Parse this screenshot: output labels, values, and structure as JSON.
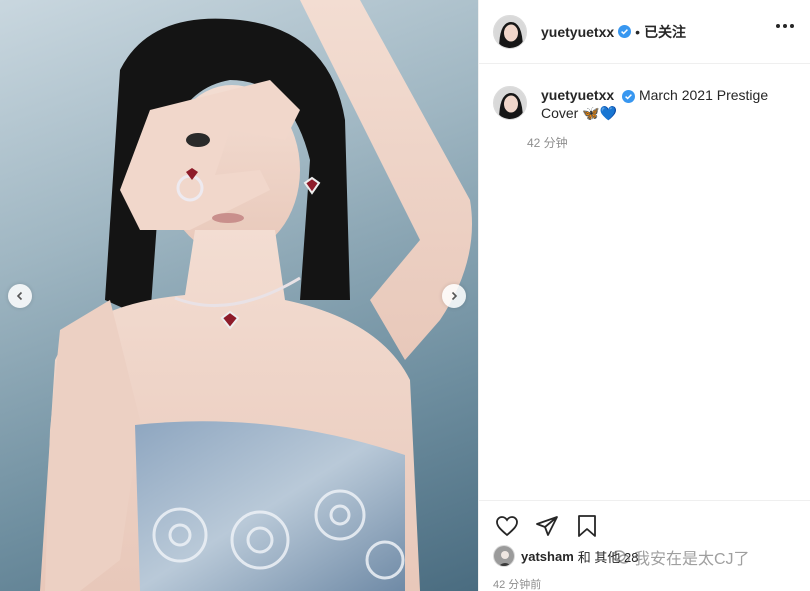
{
  "post": {
    "username": "yuetyuetxx",
    "follow_status": "已关注",
    "separator": "•",
    "caption": "March 2021 Prestige Cover",
    "caption_emojis": "🦋💙",
    "time_ago": "42 分钟",
    "liked_by_user": "yatsham",
    "liked_by_text": "和 其他 28",
    "post_time": "42 分钟前"
  },
  "watermark": {
    "text": "我安在是太CJ了"
  },
  "icons": {
    "verified": "verified-badge-icon",
    "more": "more-options-icon",
    "like": "heart-icon",
    "share": "paper-plane-icon",
    "save": "bookmark-icon",
    "prev": "chevron-left-icon",
    "next": "chevron-right-icon"
  },
  "colors": {
    "verified_blue": "#3897f0",
    "border": "#efefef",
    "muted_text": "#8e8e8e",
    "primary_text": "#262626"
  }
}
